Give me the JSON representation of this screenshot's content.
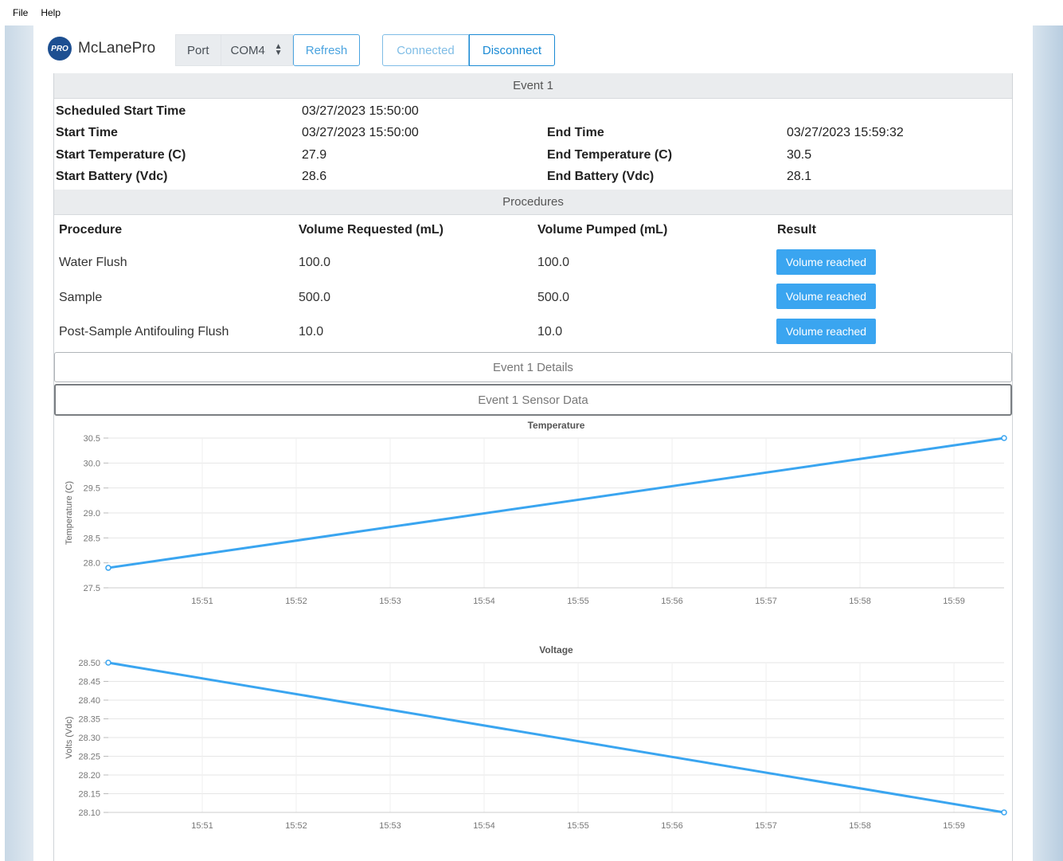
{
  "menu": {
    "file": "File",
    "help": "Help"
  },
  "brand": {
    "logo_text": "PRO",
    "name": "McLanePro"
  },
  "toolbar": {
    "port_label": "Port",
    "port_value": "COM4",
    "refresh_label": "Refresh",
    "connected_label": "Connected",
    "disconnect_label": "Disconnect"
  },
  "colors": {
    "accent": "#3aa5f0",
    "brand": "#1d4f91",
    "line": "#3aa5f0"
  },
  "event": {
    "title": "Event 1",
    "scheduled_start_label": "Scheduled Start Time",
    "scheduled_start_value": "03/27/2023 15:50:00",
    "start_time_label": "Start Time",
    "start_time_value": "03/27/2023 15:50:00",
    "start_temp_label": "Start Temperature (C)",
    "start_temp_value": "27.9",
    "start_battery_label": "Start Battery (Vdc)",
    "start_battery_value": "28.6",
    "end_time_label": "End Time",
    "end_time_value": "03/27/2023 15:59:32",
    "end_temp_label": "End Temperature (C)",
    "end_temp_value": "30.5",
    "end_battery_label": "End Battery (Vdc)",
    "end_battery_value": "28.1"
  },
  "procedures": {
    "title": "Procedures",
    "headers": [
      "Procedure",
      "Volume Requested (mL)",
      "Volume Pumped (mL)",
      "Result"
    ],
    "rows": [
      {
        "procedure": "Water Flush",
        "requested": "100.0",
        "pumped": "100.0",
        "result": "Volume reached"
      },
      {
        "procedure": "Sample",
        "requested": "500.0",
        "pumped": "500.0",
        "result": "Volume reached"
      },
      {
        "procedure": "Post-Sample Antifouling Flush",
        "requested": "10.0",
        "pumped": "10.0",
        "result": "Volume reached"
      }
    ]
  },
  "sections": {
    "details_label": "Event 1 Details",
    "sensor_label": "Event 1 Sensor Data"
  },
  "chart_data": [
    {
      "type": "line",
      "title": "Temperature",
      "ylabel": "Temperature (C)",
      "xlabel": "",
      "ylim": [
        27.5,
        30.5
      ],
      "yticks": [
        "27.5",
        "28.0",
        "28.5",
        "29.0",
        "29.5",
        "30.0",
        "30.5"
      ],
      "xticks": [
        "15:51",
        "15:52",
        "15:53",
        "15:54",
        "15:55",
        "15:56",
        "15:57",
        "15:58",
        "15:59"
      ],
      "grid": true,
      "series": [
        {
          "x": [
            "15:50:00",
            "15:59:32"
          ],
          "y": [
            27.9,
            30.5
          ]
        }
      ]
    },
    {
      "type": "line",
      "title": "Voltage",
      "ylabel": "Volts (Vdc)",
      "xlabel": "",
      "ylim": [
        28.1,
        28.5
      ],
      "yticks": [
        "28.10",
        "28.15",
        "28.20",
        "28.25",
        "28.30",
        "28.35",
        "28.40",
        "28.45",
        "28.50"
      ],
      "xticks": [
        "15:51",
        "15:52",
        "15:53",
        "15:54",
        "15:55",
        "15:56",
        "15:57",
        "15:58",
        "15:59"
      ],
      "grid": true,
      "series": [
        {
          "x": [
            "15:50:00",
            "15:59:32"
          ],
          "y": [
            28.5,
            28.1
          ]
        }
      ]
    }
  ]
}
